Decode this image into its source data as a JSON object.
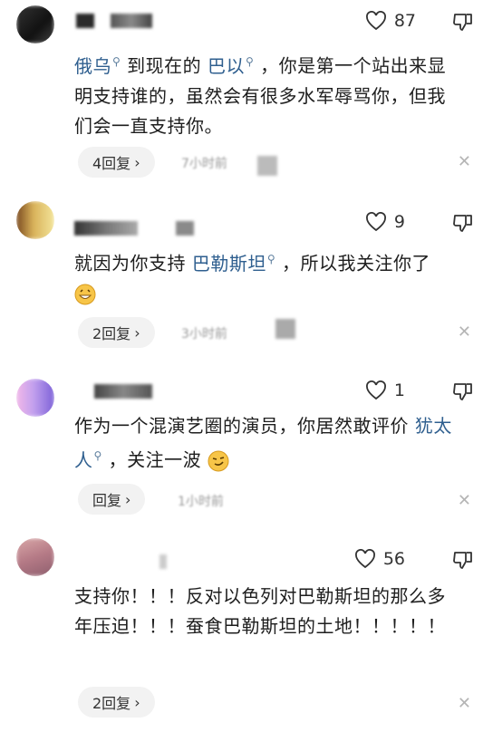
{
  "comments": [
    {
      "likes": "87",
      "text_parts": [
        "俄乌",
        "到现在的",
        "巴以",
        "，你是第一个站出来显明支持谁的，虽然会有很多水军辱骂你，但我们会一直支持你。"
      ],
      "reply": "4回复",
      "time": "7小时前"
    },
    {
      "likes": "9",
      "text_parts": [
        "就因为你支持",
        "巴勒斯坦",
        "，所以我关注你了"
      ],
      "reply": "2回复",
      "time": "3小时前"
    },
    {
      "likes": "1",
      "text_parts": [
        "作为一个混演艺圈的演员，你居然敢评价",
        "犹太人",
        "，关注一波"
      ],
      "reply": "回复",
      "time": "1小时前"
    },
    {
      "likes": "56",
      "text": "支持你！！！反对以色列对巴勒斯坦的那么多年压迫！！！蚕食巴勒斯坦的土地！！！！！",
      "reply": "2回复"
    }
  ],
  "icons": {
    "like": "heart-outline-icon",
    "dislike": "thumbs-down-icon",
    "close": "close-icon",
    "search": "search-icon",
    "chevron": "chevron-right-icon"
  },
  "colors": {
    "link": "#2f5f8f",
    "pill_bg": "#f2f2f2"
  }
}
